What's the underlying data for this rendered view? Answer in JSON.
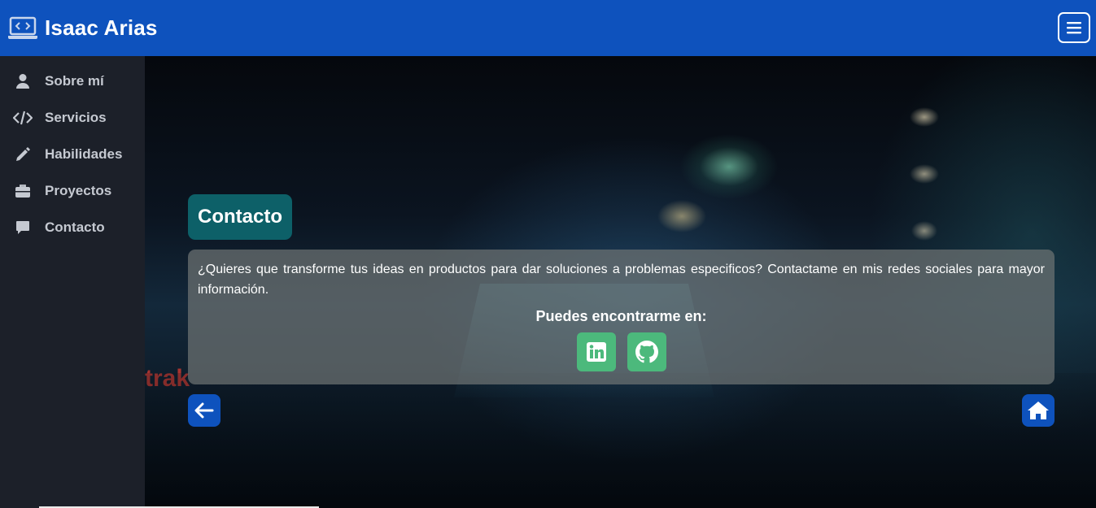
{
  "header": {
    "brand_name": "Isaac Arias",
    "brand_icon": "laptop-code-icon",
    "menu_icon": "hamburger-icon"
  },
  "sidebar": {
    "items": [
      {
        "label": "Sobre mí",
        "icon": "user-icon"
      },
      {
        "label": "Servicios",
        "icon": "code-icon"
      },
      {
        "label": "Habilidades",
        "icon": "pencil-icon"
      },
      {
        "label": "Proyectos",
        "icon": "briefcase-icon"
      },
      {
        "label": "Contacto",
        "icon": "comment-icon"
      }
    ]
  },
  "main": {
    "background_sign_text": "trak",
    "section_title": "Contacto",
    "description": "¿Quieres que transforme tus ideas en productos para dar soluciones a problemas especificos? Contactame en mis redes sociales para mayor información.",
    "social_title": "Puedes encontrarme en:",
    "social_links": [
      {
        "name": "LinkedIn",
        "icon": "linkedin-icon"
      },
      {
        "name": "GitHub",
        "icon": "github-icon"
      }
    ],
    "back_icon": "arrow-left-icon",
    "home_icon": "home-icon"
  },
  "colors": {
    "header_bg": "#0e52bd",
    "sidebar_bg": "#1c2029",
    "title_bg": "#0d6068",
    "social_btn_bg": "#4cb97c",
    "nav_btn_bg": "#0e52bd"
  }
}
